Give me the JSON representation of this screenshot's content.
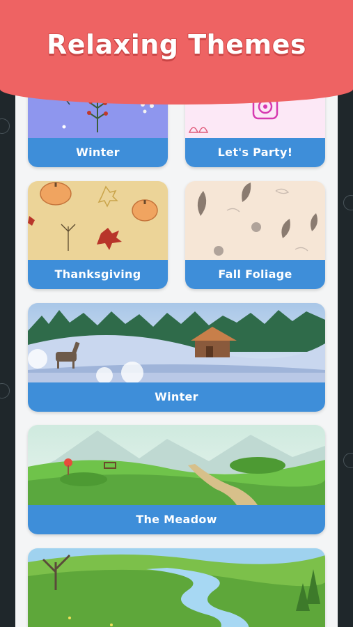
{
  "header": {
    "title": "Relaxing Themes"
  },
  "themes": [
    {
      "label": "Winter"
    },
    {
      "label": "Let's Party!"
    },
    {
      "label": "Thanksgiving"
    },
    {
      "label": "Fall Foliage"
    },
    {
      "label": "Winter"
    },
    {
      "label": "The Meadow"
    },
    {
      "label": ""
    }
  ],
  "colors": {
    "header_bg": "#ee6363",
    "card_label_bg": "#3e8ed9",
    "page_bg": "#1f272b",
    "panel_bg": "#f4f5f6"
  }
}
